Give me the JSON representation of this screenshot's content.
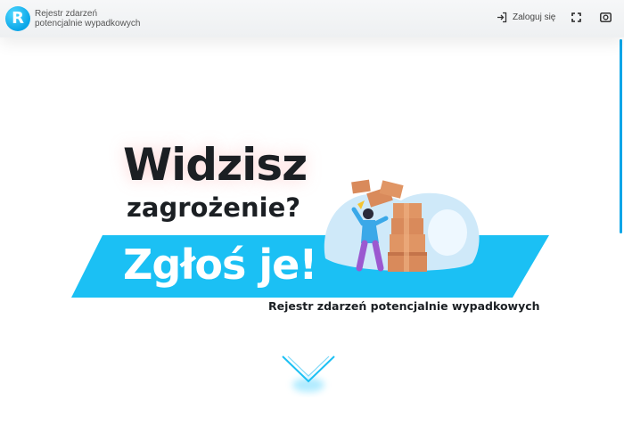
{
  "header": {
    "logo_letter": "R",
    "brand_line1": "Rejestr zdarzeń",
    "brand_line2": "potencjalnie wypadkowych",
    "login_label": "Zaloguj się",
    "icons": [
      "login-icon",
      "fullscreen-icon",
      "currency-icon"
    ]
  },
  "hero": {
    "line1": "Widzisz",
    "line2": "zagrożenie?",
    "line3": "Zgłoś je!",
    "subtitle": "Rejestr zdarzeń potencjalnie wypadkowych"
  },
  "colors": {
    "accent": "#1bc0f4",
    "text_dark": "#1b1f23",
    "box": "#d98a5b"
  }
}
